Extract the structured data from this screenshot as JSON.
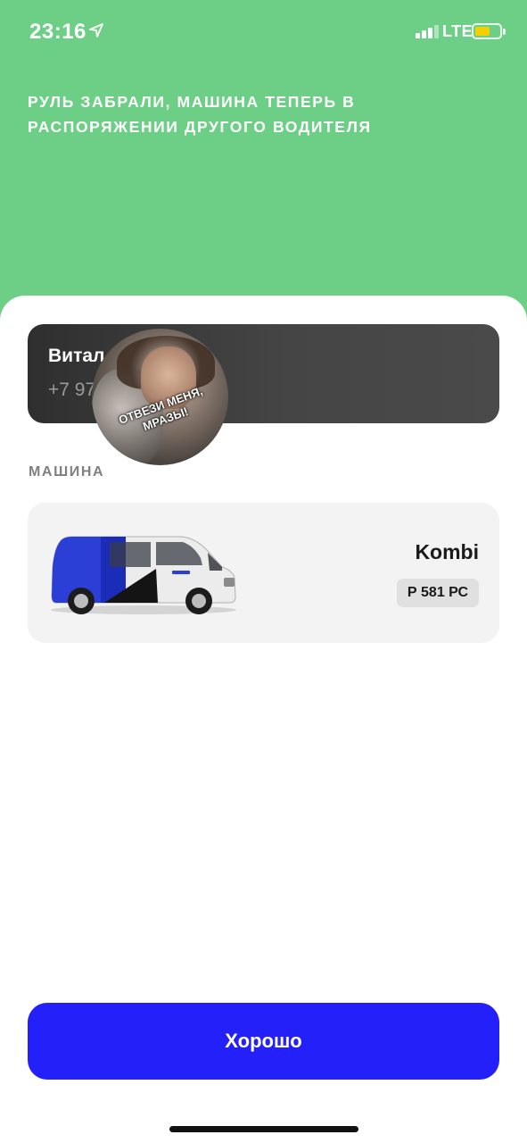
{
  "status_bar": {
    "time": "23:16",
    "network": "LTE",
    "icons": [
      "location-arrow-icon",
      "signal-bars-icon",
      "battery-icon"
    ],
    "battery_color": "#f5d000"
  },
  "header": {
    "message": "Руль забрали, машина теперь в распоряжении другого водителя",
    "background_color": "#6dcf85"
  },
  "driver": {
    "name": "Витал",
    "phone": "+7 97",
    "avatar_caption": "ОТВЕЗИ МЕНЯ, МРАЗЫ!"
  },
  "car_section": {
    "label": "Машина",
    "model": "Kombi",
    "plate": "Р 581 РС",
    "image_label": "van-image"
  },
  "actions": {
    "ok_label": "Хорошо",
    "button_color": "#2320fa"
  }
}
